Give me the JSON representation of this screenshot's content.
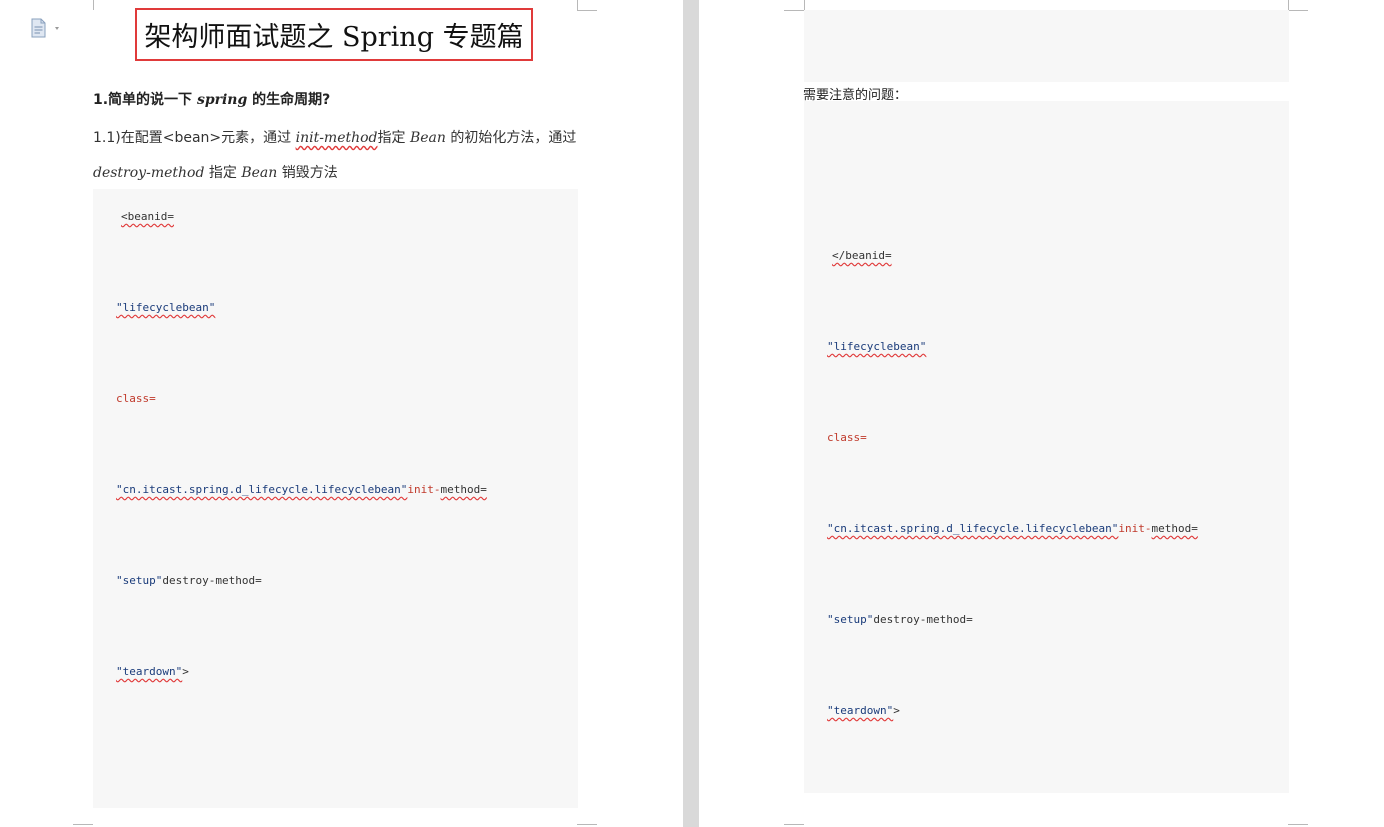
{
  "page_left": {
    "title": "架构师面试题之 Spring 专题篇",
    "question": {
      "prefix": "1.简单的说一下 ",
      "italic": "spring",
      "suffix": " 的生命周期?"
    },
    "para1": {
      "a": "1.1)在配置<bean>元素，通过 ",
      "b": "init-method",
      "c": "指定 ",
      "d": "Bean",
      "e": " 的初始化方法，通过"
    },
    "para2": {
      "a": "destroy-method",
      "b": " 指定 ",
      "c": "Bean",
      "d": " 销毁方法"
    },
    "code": {
      "l1": "<beanid=",
      "l2": "\"lifecyclebean\"",
      "l3": "class=",
      "l4a": "\"cn.itcast.spring.d_lifecycle.lifecyclebean\"",
      "l4b": "init-",
      "l4c": "method=",
      "l5a": "\"setup\"",
      "l5b": "destroy-method=",
      "l6a": "\"teardown\"",
      "l6b": ">"
    }
  },
  "page_right": {
    "note": "需要注意的问题：",
    "code": {
      "l1": "</beanid=",
      "l2": "\"lifecyclebean\"",
      "l3": "class=",
      "l4a": "\"cn.itcast.spring.d_lifecycle.lifecyclebean\"",
      "l4b": "init-",
      "l4c": "method=",
      "l5a": "\"setup\"",
      "l5b": "destroy-method=",
      "l6a": "\"teardown\"",
      "l6b": ">"
    }
  },
  "colors": {
    "title_border": "#e03a3a",
    "code_bg": "#f7f7f7",
    "string": "#1a3b7a",
    "keyword": "#c0392b",
    "gutter": "#d9d9d9"
  },
  "icons": {
    "doc_menu": "document-outline-icon"
  }
}
